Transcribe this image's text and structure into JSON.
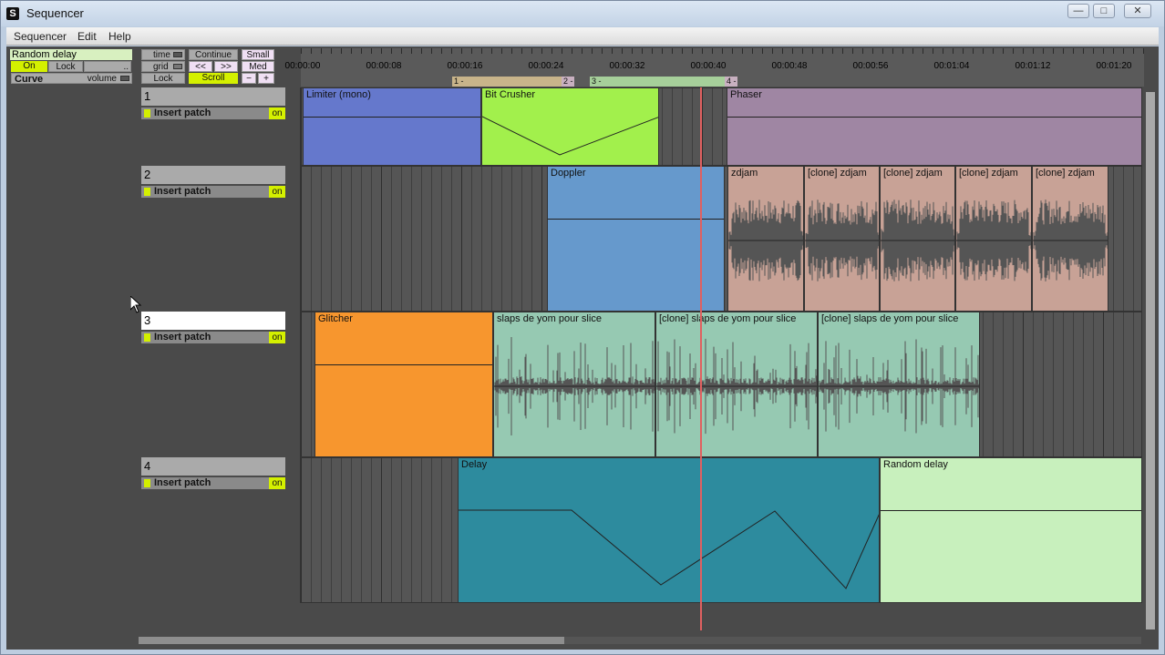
{
  "window": {
    "title": "Sequencer",
    "app_glyph": "S",
    "btn_min": "—",
    "btn_max": "□",
    "btn_close": "✕"
  },
  "menu": [
    "Sequencer",
    "Edit",
    "Help"
  ],
  "left_panel": {
    "patch_name": "Random delay",
    "on_label": "On",
    "lock_label": "Lock",
    "more_label": "..",
    "curve_label": "Curve",
    "volume_label": "volume"
  },
  "controls": {
    "time": "time",
    "continue": "Continue",
    "small": "Small",
    "grid": "grid",
    "rewind": "<<",
    "forward": ">>",
    "med": "Med",
    "lock": "Lock",
    "scroll": "Scroll",
    "minus": "−",
    "plus": "+"
  },
  "ruler": {
    "labels": [
      "00:00:00",
      "00:00:08",
      "00:00:16",
      "00:00:24",
      "00:00:32",
      "00:00:40",
      "00:00:48",
      "00:00:56",
      "00:01:04",
      "00:01:12",
      "00:01:20"
    ],
    "markers": [
      "1 -",
      "2 -",
      "3 -",
      "4 -"
    ]
  },
  "tracks": [
    {
      "name": "1",
      "insert": "Insert patch",
      "on": "on",
      "clips": [
        "Limiter (mono)",
        "Bit Crusher",
        "Phaser"
      ]
    },
    {
      "name": "2",
      "insert": "Insert patch",
      "on": "on",
      "clips": [
        "Doppler",
        "zdjam",
        "[clone] zdjam",
        "[clone] zdjam",
        "[clone] zdjam",
        "[clone] zdjam"
      ]
    },
    {
      "name": "3",
      "insert": "Insert patch",
      "on": "on",
      "clips": [
        "Glitcher",
        "slaps de yom pour slice",
        "[clone] slaps de yom pour slice",
        "[clone] slaps de yom pour slice"
      ]
    },
    {
      "name": "4",
      "insert": "Insert patch",
      "on": "on",
      "clips": [
        "Delay",
        "Random delay"
      ]
    }
  ],
  "colors": {
    "limiter": "#6578cc",
    "bitcrusher": "#a2f04c",
    "phaser": "#9f86a3",
    "doppler": "#6699cc",
    "zdjam": "#c8a296",
    "glitcher": "#f7962e",
    "slaps": "#96c9b2",
    "delay": "#2d8b9e",
    "random_delay": "#c8f0bd",
    "playhead": "#e06060",
    "accent": "#d4f000"
  }
}
